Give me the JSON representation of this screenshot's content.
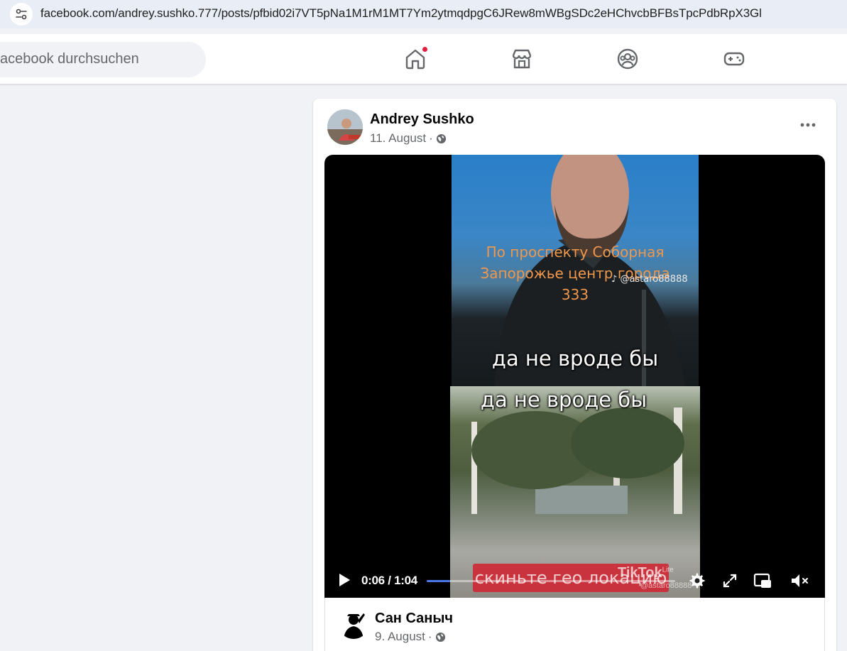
{
  "browser": {
    "url": "facebook.com/andrey.sushko.777/posts/pfbid02i7VT5pNa1M1rM1MT7Ym2ytmqdpgC6JRew8mWBgSDc2eHChvcbBFBsTpcPdbRpX3Gl",
    "site_info_icon": "tune-icon"
  },
  "header": {
    "search_placeholder": "acebook durchsuchen",
    "nav": [
      {
        "name": "home-icon",
        "notification_dot": true
      },
      {
        "name": "marketplace-icon"
      },
      {
        "name": "groups-icon"
      },
      {
        "name": "gaming-icon"
      }
    ],
    "notification_color": "#e41e3f"
  },
  "post": {
    "author": "Andrey Sushko",
    "date": "11. August",
    "separator": "·",
    "privacy_icon": "globe-icon",
    "more_icon": "more-horizontal-icon",
    "video": {
      "caption_lines": [
        "По проспекту Соборная",
        "Запорожье центр города",
        "333"
      ],
      "watermark": "@astaro88888",
      "subtitle_top": "да не вроде бы",
      "subtitle_bottom": "да не вроде бы",
      "banner_text": "скиньте гео локацию",
      "tiktok_label": "TikTok",
      "tiktok_lite": "Lite",
      "tiktok_user": "@astaro88888",
      "time_current": "0:06",
      "time_separator": "/",
      "time_total": "1:04",
      "progress_fraction": 0.094,
      "progress_color": "#4a76e8"
    }
  },
  "comment": {
    "author": "Сан Саныч",
    "date": "9. August",
    "separator": "·",
    "privacy_icon": "globe-icon"
  }
}
